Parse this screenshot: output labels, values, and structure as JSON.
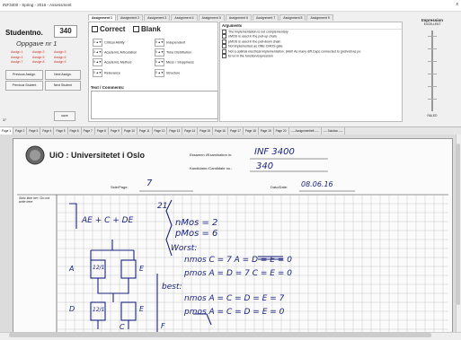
{
  "window": {
    "title": "INF3400 - Spring - 2016 - Assessment",
    "close_glyph": "x"
  },
  "student": {
    "label": "Studentno.",
    "number": "340",
    "task_title": "Oppgave nr 1",
    "assign_links": [
      "Assign 1",
      "Assign 2",
      "Assign 3",
      "Assign 4",
      "Assign 5",
      "Assign 6",
      "Assign 7",
      "Assign 8",
      "Assign 9"
    ]
  },
  "nav": {
    "prev_assign": "Previous Assign.",
    "next_assign": "Next Assign.",
    "prev_student": "Previous Student",
    "next_student": "Next Student",
    "save": "save"
  },
  "assignment_tabs": [
    "Assignment 1",
    "Assignment 2",
    "Assignment 3",
    "Assignment 4",
    "Assignment 5",
    "Assignment 6",
    "Assignment 7",
    "Assignment 8",
    "Assignment 9"
  ],
  "marks": {
    "correct": "Correct",
    "blank": "Blank"
  },
  "criteria": {
    "left": [
      "Critical Ability",
      "Academic Articulation",
      "Academic Method",
      "Relevance"
    ],
    "right": [
      "Independent",
      "Time Distribution",
      "Mess / Sloppiness",
      "Structure"
    ],
    "spin_value": "0 ▲▼"
  },
  "comments_label": "Text / Comments:",
  "arguments": {
    "header": "Arguments",
    "items": [
      "The implementation is not complementary",
      "nMOS is used in the pull-up chain",
      "pMOS is used in the pull-down chain",
      "Not implemented as ONE CMOS gate",
      "Not a optimal electrical implementation. (Hint! As many diff.Caps connected to gnd/vdd as po",
      "Error in the function/expression"
    ]
  },
  "impression": {
    "title": "Impression",
    "top": "EXCELLENT",
    "bottom": "FAILED"
  },
  "status_number": "37",
  "bottom_tabs": [
    "Page 1",
    "Page 2",
    "Page 3",
    "Page 4",
    "Page 5",
    "Page 6",
    "Page 7",
    "Page 8",
    "Page 9",
    "Page 10",
    "Page 11",
    "Page 12",
    "Page 13",
    "Page 14",
    "Page 15",
    "Page 16",
    "Page 17",
    "Page 18",
    "Page 19",
    "Page 20",
    "---- Assignmentleft ----",
    "---- Solution ----"
  ],
  "paper": {
    "university": "UiO : Universitetet i Oslo",
    "exam_label": "Eksamen i/Examination in:",
    "exam_value": "INF 3400",
    "cand_label": "Kandidatnr./Candidate no.:",
    "cand_value": "340",
    "date_label": "Dato/Date:",
    "date_value": "08.06.16",
    "page_label": "Side/Page:",
    "page_value": "7",
    "margin_note": "Skriv ikke her / Do not write here",
    "expr": "AE + C + DE",
    "n1": "21",
    "nmos": "nMos = 2",
    "pmos": "pMos = 6",
    "worst": "Worst:",
    "worst_n": "nmos   C = 7   A = D = E = 0",
    "worst_p": "pmos   A = D = 7   C = E = 0",
    "best": "best:",
    "best_n": "nmos   A = C = D = E = 7",
    "best_p": "pmos   A = C = D = E = 0",
    "lbl_a": "A",
    "lbl_d": "D",
    "lbl_e1": "E",
    "lbl_e2": "E",
    "lbl_c": "C",
    "lbl_f": "F",
    "ratio1": "12/1",
    "ratio2": "12/1"
  }
}
